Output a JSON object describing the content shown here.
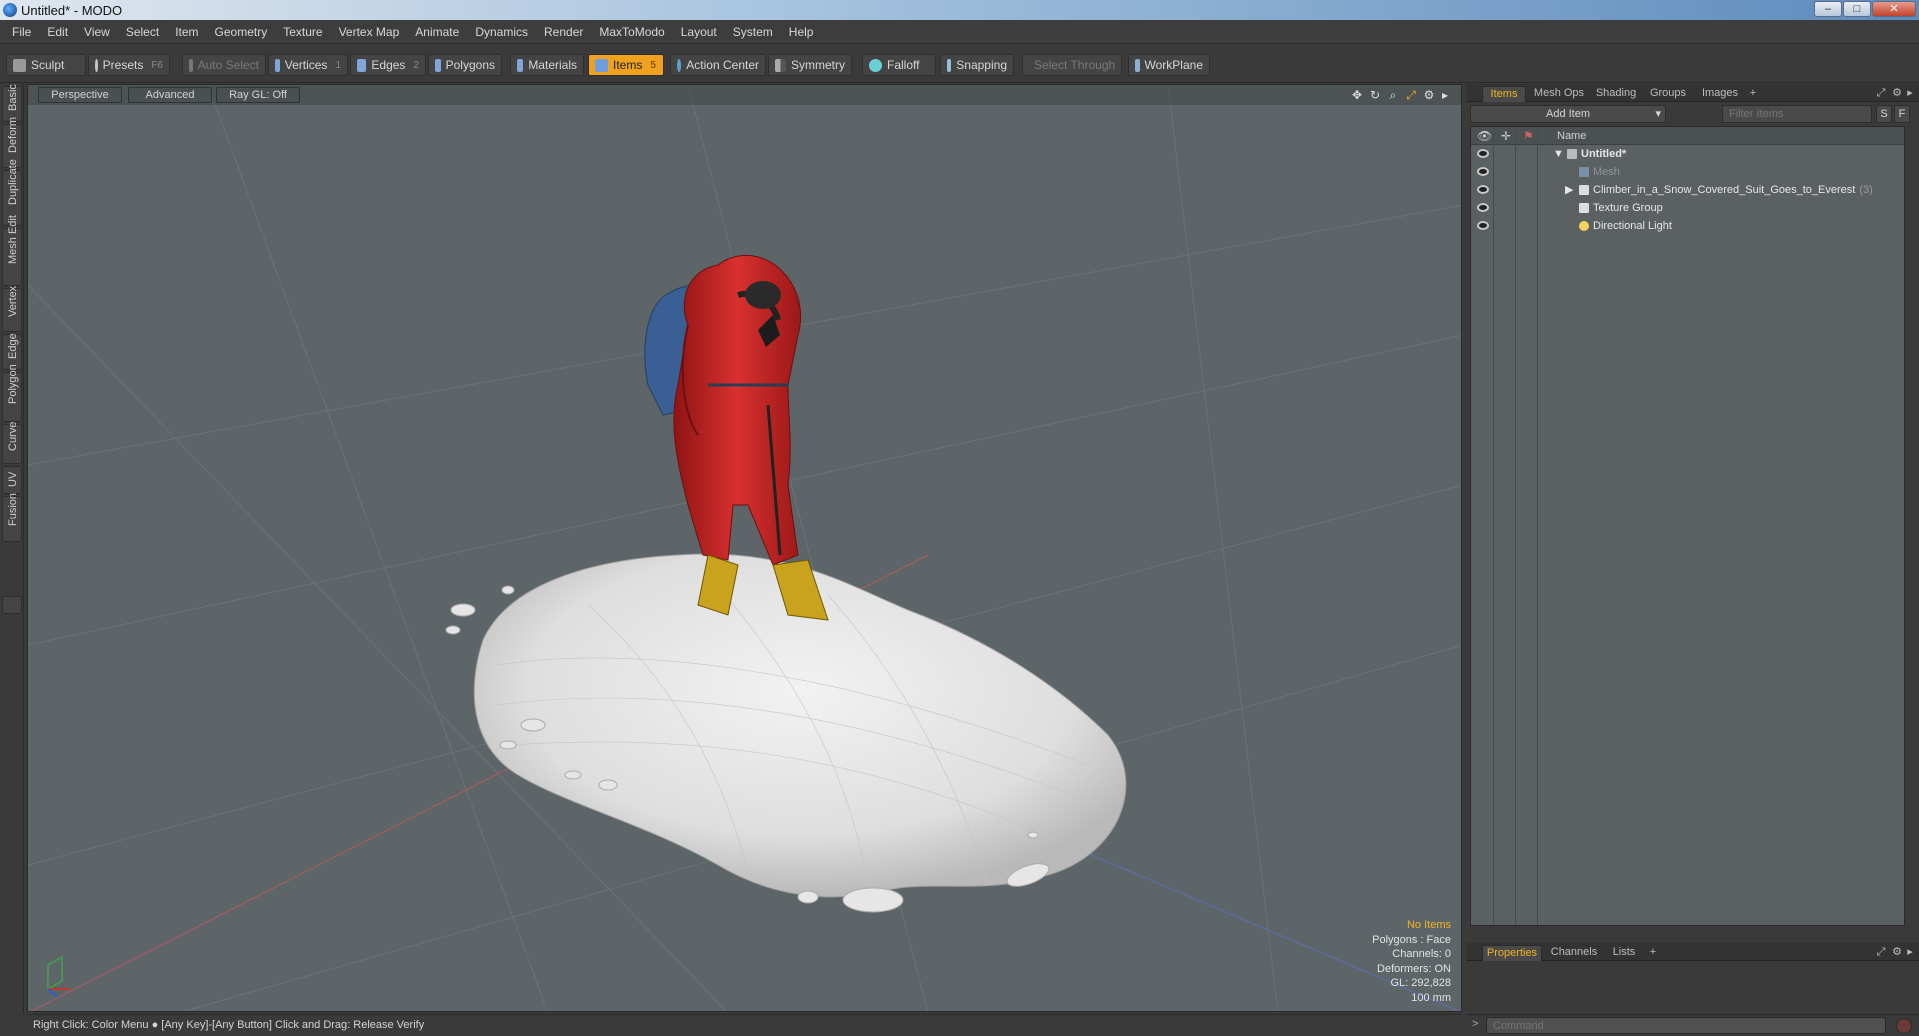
{
  "window": {
    "title": "Untitled* - MODO",
    "min": "–",
    "max": "□",
    "close": "✕"
  },
  "menu": [
    "File",
    "Edit",
    "View",
    "Select",
    "Item",
    "Geometry",
    "Texture",
    "Vertex Map",
    "Animate",
    "Dynamics",
    "Render",
    "MaxToModo",
    "Layout",
    "System",
    "Help"
  ],
  "toolbar": {
    "sculpt": "Sculpt",
    "presets": "Presets",
    "presets_key": "F6",
    "auto_select": "Auto Select",
    "vertices": "Vertices",
    "vertices_key": "1",
    "edges": "Edges",
    "edges_key": "2",
    "polygons": "Polygons",
    "materials": "Materials",
    "items": "Items",
    "items_key": "5",
    "action_center": "Action Center",
    "symmetry": "Symmetry",
    "falloff": "Falloff",
    "snapping": "Snapping",
    "select_through": "Select Through",
    "workplane": "WorkPlane"
  },
  "left_tabs": [
    "Basic",
    "Deform",
    "Duplicate",
    "Mesh Edit",
    "Vertex",
    "Edge",
    "Polygon",
    "Curve",
    "UV",
    "Fusion"
  ],
  "viewport": {
    "perspective": "Perspective",
    "advanced": "Advanced",
    "raygl": "Ray GL: Off",
    "hud": {
      "selection": "No Items",
      "polygons": "Polygons : Face",
      "channels": "Channels: 0",
      "deformers": "Deformers: ON",
      "gl": "GL: 292,828",
      "scale": "100 mm"
    }
  },
  "status": "Right Click: Color Menu ● [Any Key]-[Any Button] Click and Drag: Release Verify",
  "right_panel": {
    "tabs": [
      "Items",
      "Mesh Ops",
      "Shading",
      "Groups",
      "Images",
      "+"
    ],
    "add_item": "Add Item",
    "filter_placeholder": "Filter Items",
    "s_btn": "S",
    "f_btn": "F",
    "name_header": "Name",
    "tree": [
      {
        "label": "Untitled*"
      },
      {
        "label": "Mesh"
      },
      {
        "label": "Climber_in_a_Snow_Covered_Suit_Goes_to_Everest",
        "count": "(3)"
      },
      {
        "label": "Texture Group"
      },
      {
        "label": "Directional Light"
      }
    ],
    "bottom_tabs": [
      "Properties",
      "Channels",
      "Lists",
      "+"
    ],
    "command_placeholder": "Command"
  }
}
